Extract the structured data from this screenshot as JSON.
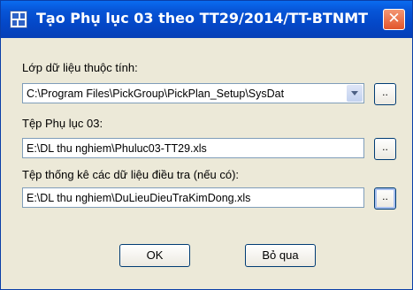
{
  "window": {
    "title": "Tạo Phụ lục 03 theo TT29/2014/TT-BTNMT",
    "close_label": "✕"
  },
  "form": {
    "layer_label": "Lớp dữ liệu thuộc tính:",
    "layer_value": "C:\\Program Files\\PickGroup\\PickPlan_Setup\\SysDat",
    "appendix_label": "Tệp Phụ lục 03:",
    "appendix_value": "E:\\DL thu nghiem\\Phuluc03-TT29.xls",
    "survey_label": "Tệp thống kê các dữ liệu điều tra (nếu có):",
    "survey_value": "E:\\DL thu nghiem\\DuLieuDieuTraKimDong.xls",
    "browse_label": ".."
  },
  "buttons": {
    "ok_label": "OK",
    "cancel_label": "Bỏ qua"
  },
  "colors": {
    "titlebar": "#0756d8",
    "body": "#ece9d8",
    "close": "#e2552b",
    "field_border": "#7f9db9"
  }
}
